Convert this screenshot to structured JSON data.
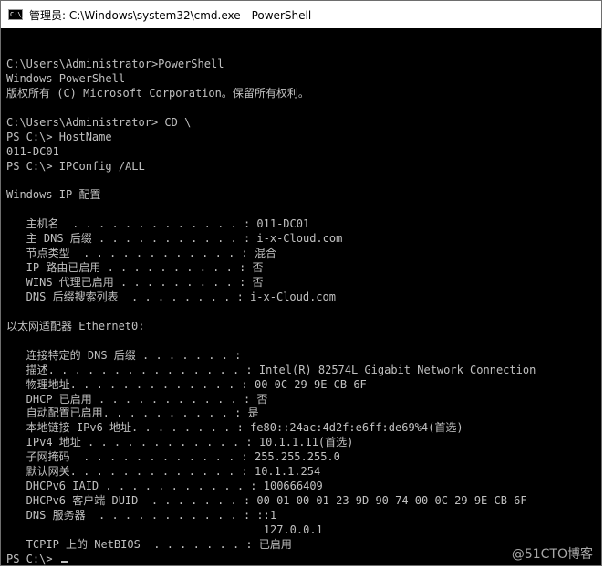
{
  "window": {
    "title": "管理员: C:\\Windows\\system32\\cmd.exe - PowerShell",
    "icon": "console-icon",
    "icon_text": "C:\\_"
  },
  "colors": {
    "console_background": "#000000",
    "console_text": "#c0c0c0",
    "titlebar_background": "#ffffff"
  },
  "console": {
    "lines": [
      "",
      "C:\\Users\\Administrator>PowerShell",
      "Windows PowerShell",
      "版权所有 (C) Microsoft Corporation。保留所有权利。",
      "",
      "C:\\Users\\Administrator> CD \\",
      "PS C:\\> HostName",
      "011-DC01",
      "PS C:\\> IPConfig /ALL",
      "",
      "Windows IP 配置",
      "",
      "   主机名  . . . . . . . . . . . . . : 011-DC01",
      "   主 DNS 后缀 . . . . . . . . . . . : i-x-Cloud.com",
      "   节点类型  . . . . . . . . . . . . : 混合",
      "   IP 路由已启用 . . . . . . . . . . : 否",
      "   WINS 代理已启用 . . . . . . . . . : 否",
      "   DNS 后缀搜索列表  . . . . . . . . : i-x-Cloud.com",
      "",
      "以太网适配器 Ethernet0:",
      "",
      "   连接特定的 DNS 后缀 . . . . . . . :",
      "   描述. . . . . . . . . . . . . . . : Intel(R) 82574L Gigabit Network Connection",
      "   物理地址. . . . . . . . . . . . . : 00-0C-29-9E-CB-6F",
      "   DHCP 已启用 . . . . . . . . . . . : 否",
      "   自动配置已启用. . . . . . . . . . : 是",
      "   本地链接 IPv6 地址. . . . . . . . : fe80::24ac:4d2f:e6ff:de69%4(首选)",
      "   IPv4 地址 . . . . . . . . . . . . : 10.1.1.11(首选)",
      "   子网掩码  . . . . . . . . . . . . : 255.255.255.0",
      "   默认网关. . . . . . . . . . . . . : 10.1.1.254",
      "   DHCPv6 IAID . . . . . . . . . . . : 100666409",
      "   DHCPv6 客户端 DUID  . . . . . . . : 00-01-00-01-23-9D-90-74-00-0C-29-9E-CB-6F",
      "   DNS 服务器  . . . . . . . . . . . : ::1",
      "                                       127.0.0.1",
      "   TCPIP 上的 NetBIOS  . . . . . . . : 已启用"
    ],
    "prompt": "PS C:\\> "
  },
  "watermark": "@51CTO博客"
}
